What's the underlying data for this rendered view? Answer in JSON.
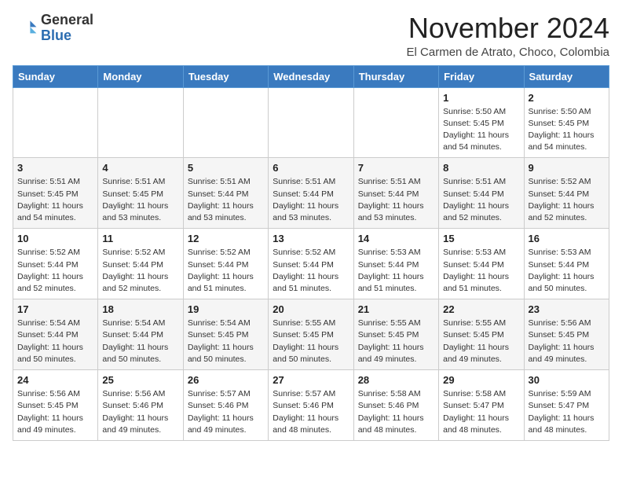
{
  "header": {
    "logo_general": "General",
    "logo_blue": "Blue",
    "month_title": "November 2024",
    "location": "El Carmen de Atrato, Choco, Colombia"
  },
  "days_of_week": [
    "Sunday",
    "Monday",
    "Tuesday",
    "Wednesday",
    "Thursday",
    "Friday",
    "Saturday"
  ],
  "weeks": [
    [
      {
        "day": "",
        "info": ""
      },
      {
        "day": "",
        "info": ""
      },
      {
        "day": "",
        "info": ""
      },
      {
        "day": "",
        "info": ""
      },
      {
        "day": "",
        "info": ""
      },
      {
        "day": "1",
        "info": "Sunrise: 5:50 AM\nSunset: 5:45 PM\nDaylight: 11 hours\nand 54 minutes."
      },
      {
        "day": "2",
        "info": "Sunrise: 5:50 AM\nSunset: 5:45 PM\nDaylight: 11 hours\nand 54 minutes."
      }
    ],
    [
      {
        "day": "3",
        "info": "Sunrise: 5:51 AM\nSunset: 5:45 PM\nDaylight: 11 hours\nand 54 minutes."
      },
      {
        "day": "4",
        "info": "Sunrise: 5:51 AM\nSunset: 5:45 PM\nDaylight: 11 hours\nand 53 minutes."
      },
      {
        "day": "5",
        "info": "Sunrise: 5:51 AM\nSunset: 5:44 PM\nDaylight: 11 hours\nand 53 minutes."
      },
      {
        "day": "6",
        "info": "Sunrise: 5:51 AM\nSunset: 5:44 PM\nDaylight: 11 hours\nand 53 minutes."
      },
      {
        "day": "7",
        "info": "Sunrise: 5:51 AM\nSunset: 5:44 PM\nDaylight: 11 hours\nand 53 minutes."
      },
      {
        "day": "8",
        "info": "Sunrise: 5:51 AM\nSunset: 5:44 PM\nDaylight: 11 hours\nand 52 minutes."
      },
      {
        "day": "9",
        "info": "Sunrise: 5:52 AM\nSunset: 5:44 PM\nDaylight: 11 hours\nand 52 minutes."
      }
    ],
    [
      {
        "day": "10",
        "info": "Sunrise: 5:52 AM\nSunset: 5:44 PM\nDaylight: 11 hours\nand 52 minutes."
      },
      {
        "day": "11",
        "info": "Sunrise: 5:52 AM\nSunset: 5:44 PM\nDaylight: 11 hours\nand 52 minutes."
      },
      {
        "day": "12",
        "info": "Sunrise: 5:52 AM\nSunset: 5:44 PM\nDaylight: 11 hours\nand 51 minutes."
      },
      {
        "day": "13",
        "info": "Sunrise: 5:52 AM\nSunset: 5:44 PM\nDaylight: 11 hours\nand 51 minutes."
      },
      {
        "day": "14",
        "info": "Sunrise: 5:53 AM\nSunset: 5:44 PM\nDaylight: 11 hours\nand 51 minutes."
      },
      {
        "day": "15",
        "info": "Sunrise: 5:53 AM\nSunset: 5:44 PM\nDaylight: 11 hours\nand 51 minutes."
      },
      {
        "day": "16",
        "info": "Sunrise: 5:53 AM\nSunset: 5:44 PM\nDaylight: 11 hours\nand 50 minutes."
      }
    ],
    [
      {
        "day": "17",
        "info": "Sunrise: 5:54 AM\nSunset: 5:44 PM\nDaylight: 11 hours\nand 50 minutes."
      },
      {
        "day": "18",
        "info": "Sunrise: 5:54 AM\nSunset: 5:44 PM\nDaylight: 11 hours\nand 50 minutes."
      },
      {
        "day": "19",
        "info": "Sunrise: 5:54 AM\nSunset: 5:45 PM\nDaylight: 11 hours\nand 50 minutes."
      },
      {
        "day": "20",
        "info": "Sunrise: 5:55 AM\nSunset: 5:45 PM\nDaylight: 11 hours\nand 50 minutes."
      },
      {
        "day": "21",
        "info": "Sunrise: 5:55 AM\nSunset: 5:45 PM\nDaylight: 11 hours\nand 49 minutes."
      },
      {
        "day": "22",
        "info": "Sunrise: 5:55 AM\nSunset: 5:45 PM\nDaylight: 11 hours\nand 49 minutes."
      },
      {
        "day": "23",
        "info": "Sunrise: 5:56 AM\nSunset: 5:45 PM\nDaylight: 11 hours\nand 49 minutes."
      }
    ],
    [
      {
        "day": "24",
        "info": "Sunrise: 5:56 AM\nSunset: 5:45 PM\nDaylight: 11 hours\nand 49 minutes."
      },
      {
        "day": "25",
        "info": "Sunrise: 5:56 AM\nSunset: 5:46 PM\nDaylight: 11 hours\nand 49 minutes."
      },
      {
        "day": "26",
        "info": "Sunrise: 5:57 AM\nSunset: 5:46 PM\nDaylight: 11 hours\nand 49 minutes."
      },
      {
        "day": "27",
        "info": "Sunrise: 5:57 AM\nSunset: 5:46 PM\nDaylight: 11 hours\nand 48 minutes."
      },
      {
        "day": "28",
        "info": "Sunrise: 5:58 AM\nSunset: 5:46 PM\nDaylight: 11 hours\nand 48 minutes."
      },
      {
        "day": "29",
        "info": "Sunrise: 5:58 AM\nSunset: 5:47 PM\nDaylight: 11 hours\nand 48 minutes."
      },
      {
        "day": "30",
        "info": "Sunrise: 5:59 AM\nSunset: 5:47 PM\nDaylight: 11 hours\nand 48 minutes."
      }
    ]
  ]
}
